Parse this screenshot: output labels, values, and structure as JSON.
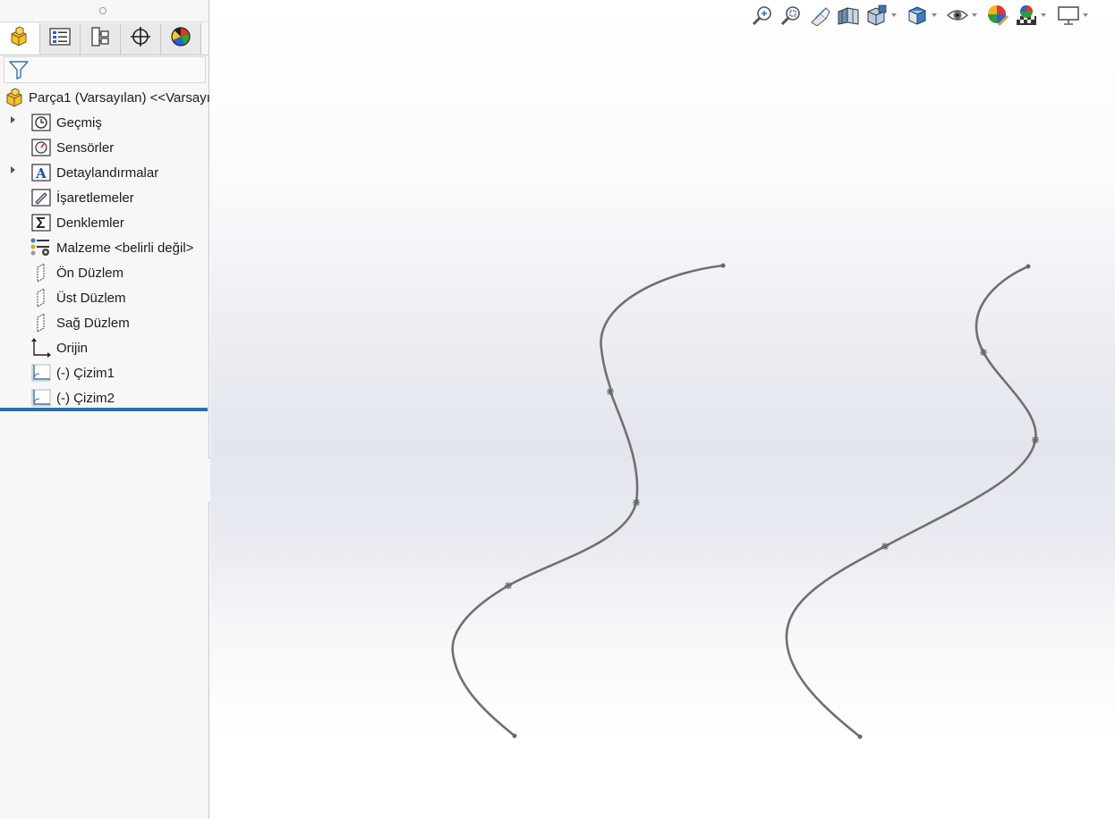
{
  "feature_tree": {
    "root": {
      "label": "Parça1 (Varsayılan) <<Varsayı",
      "icon": "part-icon"
    },
    "items": [
      {
        "label": "Geçmiş",
        "icon": "history-icon",
        "expandable": true
      },
      {
        "label": "Sensörler",
        "icon": "sensor-icon",
        "expandable": false
      },
      {
        "label": "Detaylandırmalar",
        "icon": "annotations-icon",
        "expandable": true
      },
      {
        "label": "İşaretlemeler",
        "icon": "markup-icon",
        "expandable": false
      },
      {
        "label": "Denklemler",
        "icon": "equations-icon",
        "expandable": false
      },
      {
        "label": "Malzeme <belirli değil>",
        "icon": "material-icon",
        "expandable": false
      },
      {
        "label": "Ön Düzlem",
        "icon": "plane-icon",
        "expandable": false
      },
      {
        "label": "Üst Düzlem",
        "icon": "plane-icon",
        "expandable": false
      },
      {
        "label": "Sağ Düzlem",
        "icon": "plane-icon",
        "expandable": false
      },
      {
        "label": "Orijin",
        "icon": "origin-icon",
        "expandable": false
      },
      {
        "label": "(-) Çizim1",
        "icon": "sketch-icon",
        "expandable": false
      },
      {
        "label": "(-) Çizim2",
        "icon": "sketch-icon",
        "expandable": false
      }
    ]
  },
  "manager_tabs": [
    {
      "icon": "feature-manager-icon",
      "active": true
    },
    {
      "icon": "property-manager-icon",
      "active": false
    },
    {
      "icon": "configuration-manager-icon",
      "active": false
    },
    {
      "icon": "dimxpert-manager-icon",
      "active": false
    },
    {
      "icon": "display-manager-icon",
      "active": false
    }
  ],
  "heads_up_toolbar": [
    {
      "icon": "zoom-to-fit-icon",
      "has_menu": false
    },
    {
      "icon": "zoom-to-area-icon",
      "has_menu": false
    },
    {
      "icon": "previous-view-icon",
      "has_menu": false
    },
    {
      "icon": "section-view-icon",
      "has_menu": false
    },
    {
      "icon": "view-orientation-icon",
      "has_menu": true
    },
    {
      "icon": "display-style-icon",
      "has_menu": true
    },
    {
      "icon": "hide-show-items-icon",
      "has_menu": true
    },
    {
      "icon": "edit-appearance-icon",
      "has_menu": false
    },
    {
      "icon": "apply-scene-icon",
      "has_menu": true
    },
    {
      "icon": "view-settings-icon",
      "has_menu": true
    }
  ],
  "colors": {
    "curve": "#707070",
    "rollback_bar": "#2e6fa6",
    "panel_bg": "#f7f7f7"
  }
}
